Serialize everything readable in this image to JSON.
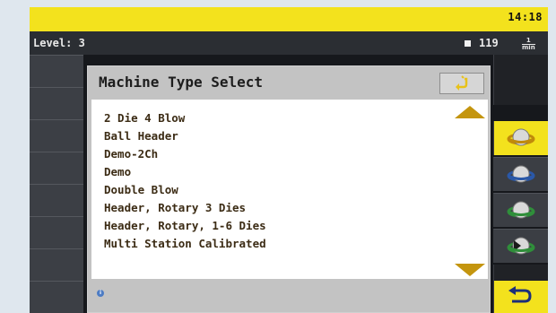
{
  "header": {
    "time": "14:18"
  },
  "status": {
    "level_label": "Level:",
    "level_value": "3",
    "rpm_value": "119",
    "rpm_unit_top": "1",
    "rpm_unit_bottom": "min"
  },
  "dialog": {
    "title": "Machine Type Select",
    "back_icon": "return-arrow-icon",
    "items": [
      "2 Die 4 Blow",
      "Ball Header",
      "Demo-2Ch",
      "Demo",
      "Double Blow",
      "Header, Rotary 3 Dies",
      "Header, Rotary, 1-6 Dies",
      "Multi Station Calibrated"
    ],
    "scroll_up_icon": "scroll-up-arrow-icon",
    "scroll_down_icon": "scroll-down-arrow-icon",
    "info_icon": "info-icon"
  },
  "sidebar_right": {
    "buttons": [
      {
        "icon": "ring-view-1-icon",
        "active": true
      },
      {
        "icon": "ring-view-2-icon",
        "active": false
      },
      {
        "icon": "ring-view-3-icon",
        "active": false
      },
      {
        "icon": "ring-view-4-icon",
        "active": false
      },
      {
        "icon": "return-icon",
        "active": true
      }
    ]
  },
  "colors": {
    "accent": "#f3e21d",
    "panel": "#3c3f45",
    "text_dark": "#3c2c15",
    "arrow": "#c4950e"
  }
}
